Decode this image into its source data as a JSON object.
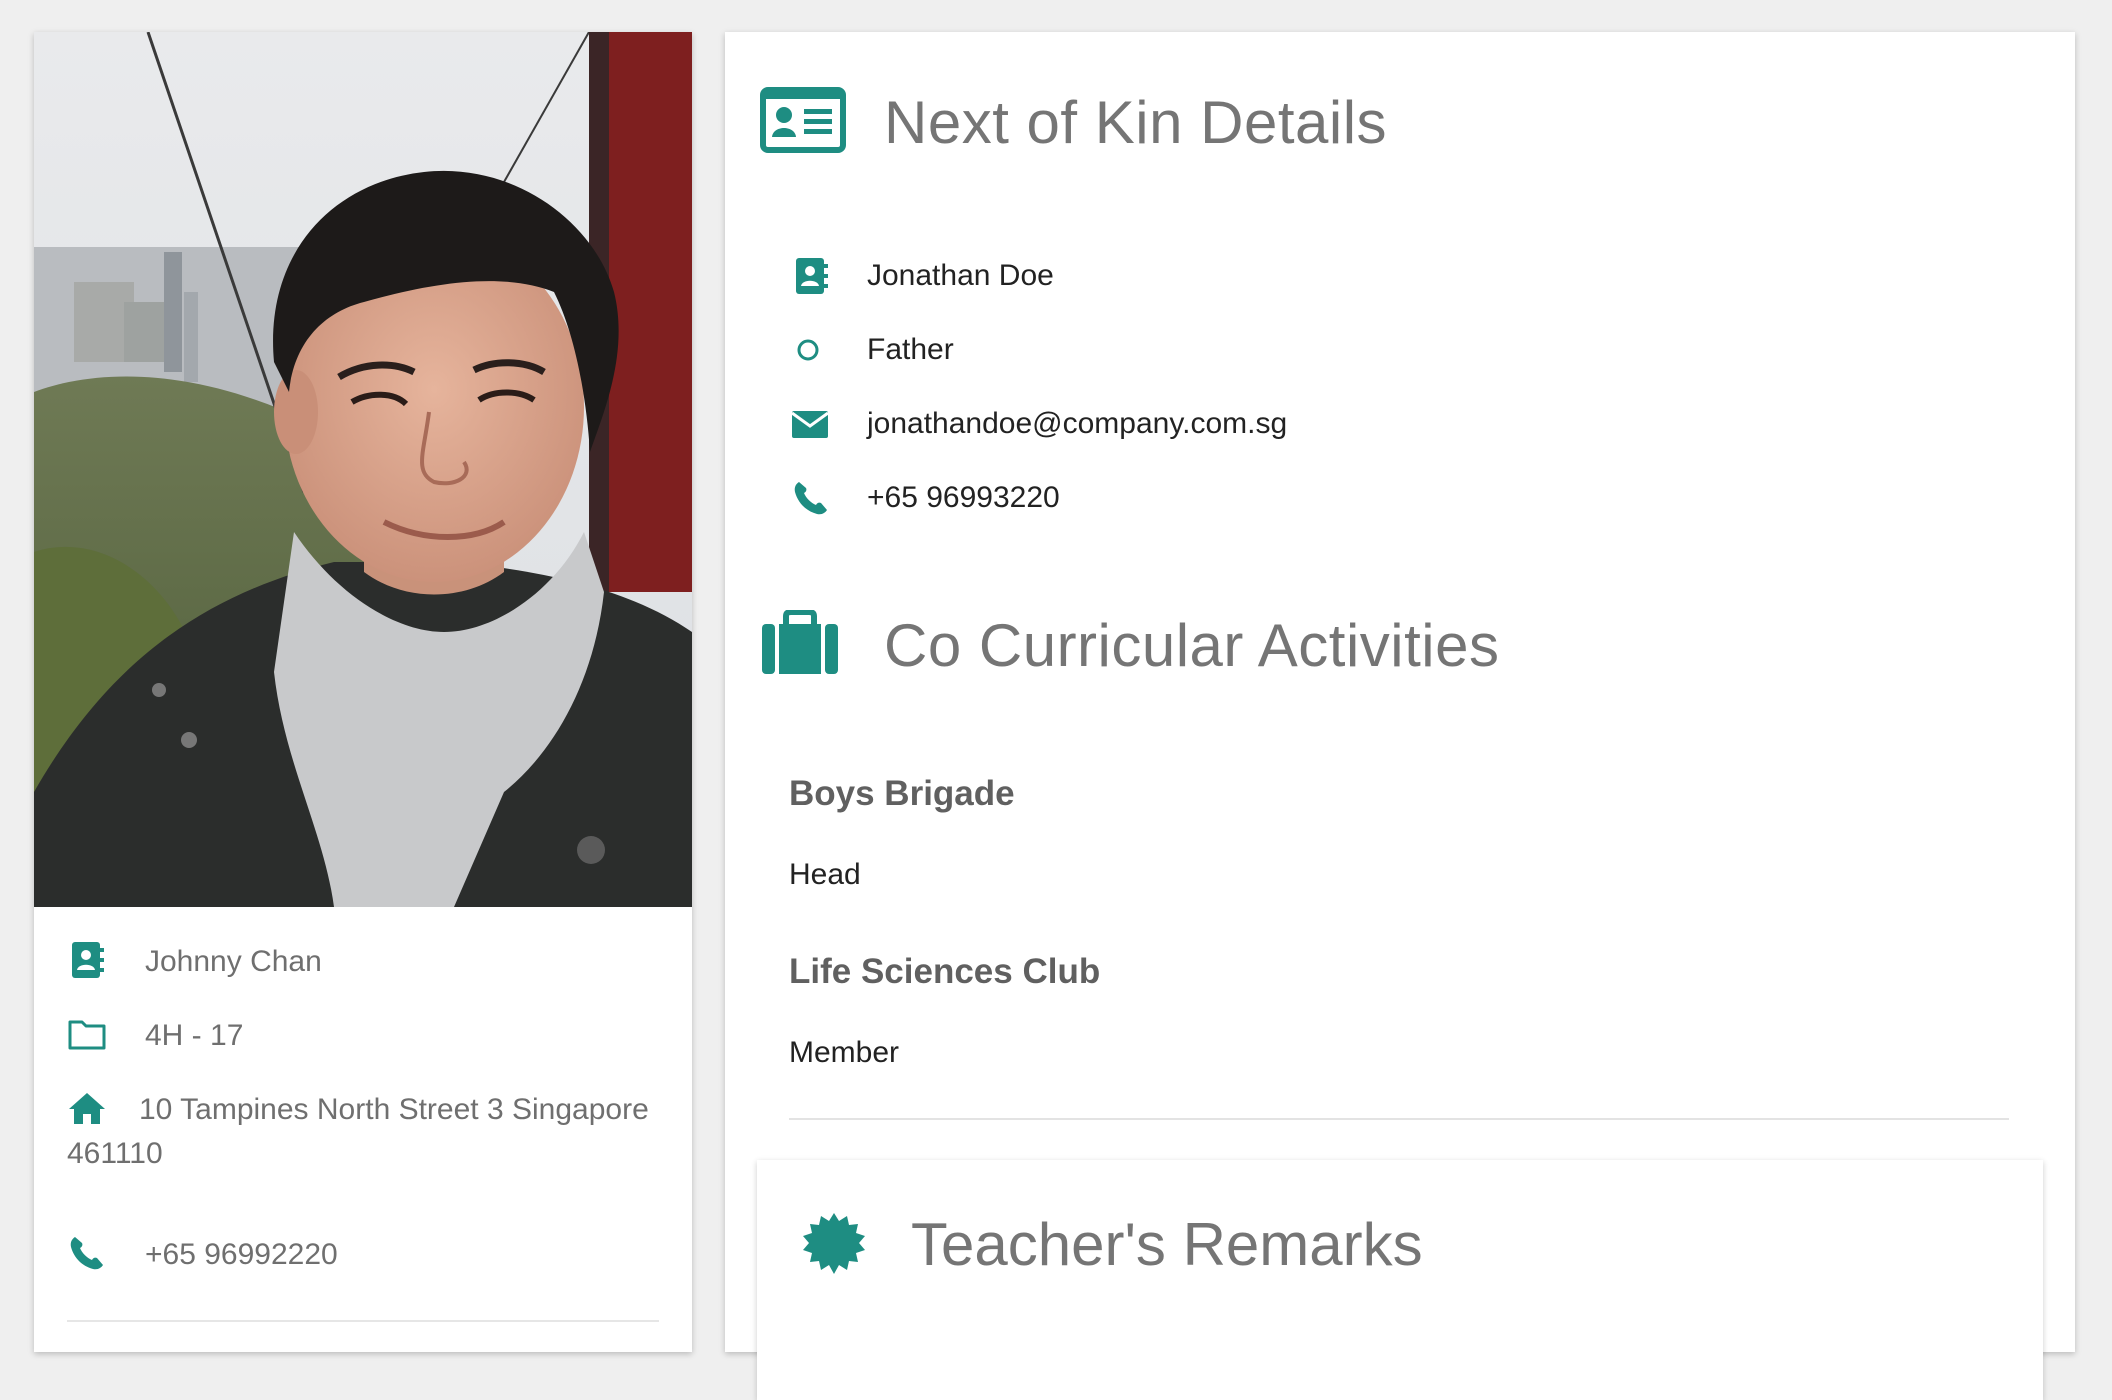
{
  "student": {
    "name": "Johnny Chan",
    "class": "4H - 17",
    "address": "10 Tampines North Street 3 Singapore 461110",
    "phone": "+65 96992220"
  },
  "next_of_kin": {
    "heading": "Next of Kin Details",
    "name": "Jonathan Doe",
    "relationship": "Father",
    "email": "jonathandoe@company.com.sg",
    "phone": "+65 96993220"
  },
  "cca": {
    "heading": "Co Curricular Activities",
    "items": [
      {
        "name": "Boys Brigade",
        "role": "Head"
      },
      {
        "name": "Life Sciences Club",
        "role": "Member"
      }
    ]
  },
  "remarks": {
    "heading": "Teacher's Remarks"
  },
  "icons": {
    "contact": "contact-card-icon",
    "folder": "folder-icon",
    "home": "home-icon",
    "phone": "phone-icon",
    "circle": "circle-outline-icon",
    "envelope": "envelope-icon",
    "id_card": "id-card-icon",
    "briefcase": "briefcase-icon",
    "badge": "certificate-icon"
  },
  "colors": {
    "accent": "#1e8d82",
    "heading": "#757575",
    "background": "#efefef"
  }
}
